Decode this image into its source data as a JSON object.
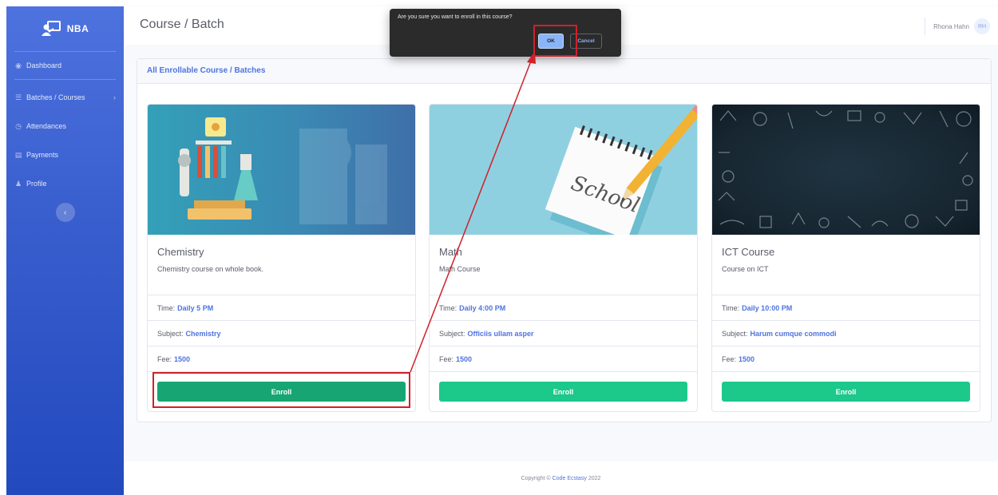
{
  "sidebar": {
    "brand": "NBA",
    "items": [
      {
        "label": "Dashboard",
        "icon": "dashboard-icon"
      },
      {
        "label": "Batches / Courses",
        "icon": "list-icon",
        "has_chevron": true
      },
      {
        "label": "Attendances",
        "icon": "clock-icon"
      },
      {
        "label": "Payments",
        "icon": "table-icon"
      },
      {
        "label": "Profile",
        "icon": "user-icon"
      }
    ],
    "toggle_glyph": "‹"
  },
  "topbar": {
    "title": "Course / Batch",
    "user_name": "Rhona Hahn",
    "avatar_initials": "RH"
  },
  "panel": {
    "header": "All Enrollable Course / Batches"
  },
  "courses": [
    {
      "title": "Chemistry",
      "description": "Chemistry course on whole book.",
      "time_label": "Time:",
      "time": "Daily 5 PM",
      "subject_label": "Subject:",
      "subject": "Chemistry",
      "fee_label": "Fee:",
      "fee": "1500",
      "button": "Enroll",
      "image": "chemistry-lab-illustration"
    },
    {
      "title": "Math",
      "description": "Math Course",
      "time_label": "Time:",
      "time": "Daily 4:00 PM",
      "subject_label": "Subject:",
      "subject": "Officiis ullam asper",
      "fee_label": "Fee:",
      "fee": "1500",
      "button": "Enroll",
      "image": "school-notebook-pencil",
      "image_text": "School"
    },
    {
      "title": "ICT Course",
      "description": "Course on ICT",
      "time_label": "Time:",
      "time": "Daily 10:00 PM",
      "subject_label": "Subject:",
      "subject": "Harum cumque commodi",
      "fee_label": "Fee:",
      "fee": "1500",
      "button": "Enroll",
      "image": "chalkboard-doodles"
    }
  ],
  "dialog": {
    "message": "Are you sure you want to enroll in this course?",
    "ok": "OK",
    "cancel": "Cancel"
  },
  "footer": {
    "prefix": "Copyright ©",
    "link": "Code Ecstasy",
    "year": "2022"
  },
  "colors": {
    "sidebar": "#4e73df",
    "accent": "#4e73df",
    "enroll": "#1cc88a",
    "annotation": "#d0202a"
  }
}
